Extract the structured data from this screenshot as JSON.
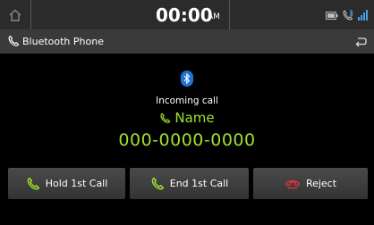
{
  "status_bar": {
    "time": "00:00",
    "ampm": "AM",
    "icons": [
      "home-icon",
      "battery-icon",
      "bluetooth-phone-icon",
      "signal-icon"
    ]
  },
  "title_bar": {
    "title": "Bluetooth Phone",
    "icon": "phone-handset-icon",
    "back_icon": "back-icon"
  },
  "call": {
    "badge_icon": "bluetooth-icon",
    "status": "Incoming call",
    "name": "Name",
    "number": "000-0000-0000"
  },
  "buttons": {
    "hold": "Hold 1st Call",
    "end": "End 1st Call",
    "reject": "Reject"
  },
  "colors": {
    "accent_green": "#9ee030",
    "reject_red": "#e0303a",
    "bluetooth_blue": "#1e72d8"
  }
}
